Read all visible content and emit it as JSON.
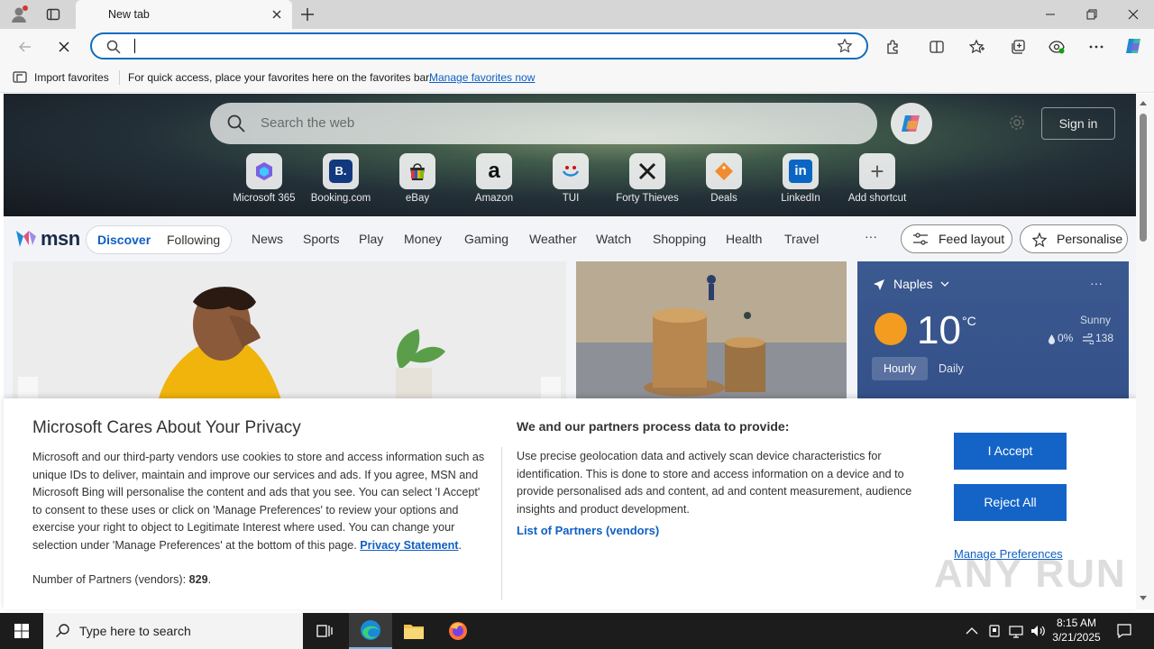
{
  "browser": {
    "tab_title": "New tab",
    "favorites_bar": {
      "import_label": "Import favorites",
      "message": "For quick access, place your favorites here on the favorites bar.",
      "manage_link": "Manage favorites now"
    },
    "accent_color": "#0f6cbd"
  },
  "newtab": {
    "search_placeholder": "Search the web",
    "sign_in": "Sign in",
    "shortcuts": [
      {
        "label": "Microsoft 365",
        "icon": "microsoft-365-icon"
      },
      {
        "label": "Booking.com",
        "icon": "booking-icon",
        "glyph": "B."
      },
      {
        "label": "eBay",
        "icon": "ebay-icon"
      },
      {
        "label": "Amazon",
        "icon": "amazon-icon",
        "glyph": "a"
      },
      {
        "label": "TUI",
        "icon": "tui-icon"
      },
      {
        "label": "Forty Thieves",
        "icon": "forty-thieves-icon"
      },
      {
        "label": "Deals",
        "icon": "deals-icon"
      },
      {
        "label": "LinkedIn",
        "icon": "linkedin-icon",
        "glyph": "in"
      },
      {
        "label": "Add shortcut",
        "icon": "plus-icon",
        "glyph": "+"
      }
    ],
    "logo_text": "msn",
    "feed_tabs": {
      "active": "Discover",
      "other": "Following"
    },
    "nav_items": [
      "News",
      "Sports",
      "Play",
      "Money",
      "Gaming",
      "Weather",
      "Watch",
      "Shopping",
      "Health",
      "Travel"
    ],
    "more": "···",
    "feed_layout": "Feed layout",
    "personalise": "Personalise"
  },
  "weather": {
    "city": "Naples",
    "temp": "10",
    "unit": "°C",
    "condition": "Sunny",
    "precip": "0%",
    "wind": "138",
    "tab_hourly": "Hourly",
    "tab_daily": "Daily"
  },
  "consent": {
    "title": "Microsoft Cares About Your Privacy",
    "body": "Microsoft and our third-party vendors use cookies to store and access information such as unique IDs to deliver, maintain and improve our services and ads. If you agree, MSN and Microsoft Bing will personalise the content and ads that you see. You can select 'I Accept' to consent to these uses or click on 'Manage Preferences' to review your options and exercise your right to object to Legitimate Interest where used.  You can change your selection under 'Manage Preferences' at the bottom of this page.",
    "privacy_link": "Privacy Statement",
    "partners_count_label": "Number of Partners (vendors):",
    "partners_count": "829",
    "partners_heading": "We and our partners process data to provide:",
    "purposes": "Use precise geolocation data and actively scan device characteristics for identification. This is done to store and access information on a device and to provide personalised ads and content, ad and content measurement, audience insights and product development.",
    "partners_link": "List of Partners (vendors)",
    "accept": "I Accept",
    "reject": "Reject All",
    "manage": "Manage Preferences",
    "button_color": "#1464c8"
  },
  "watermark": "ANY RUN",
  "taskbar": {
    "search_placeholder": "Type here to search",
    "time": "8:15 AM",
    "date": "3/21/2025"
  }
}
